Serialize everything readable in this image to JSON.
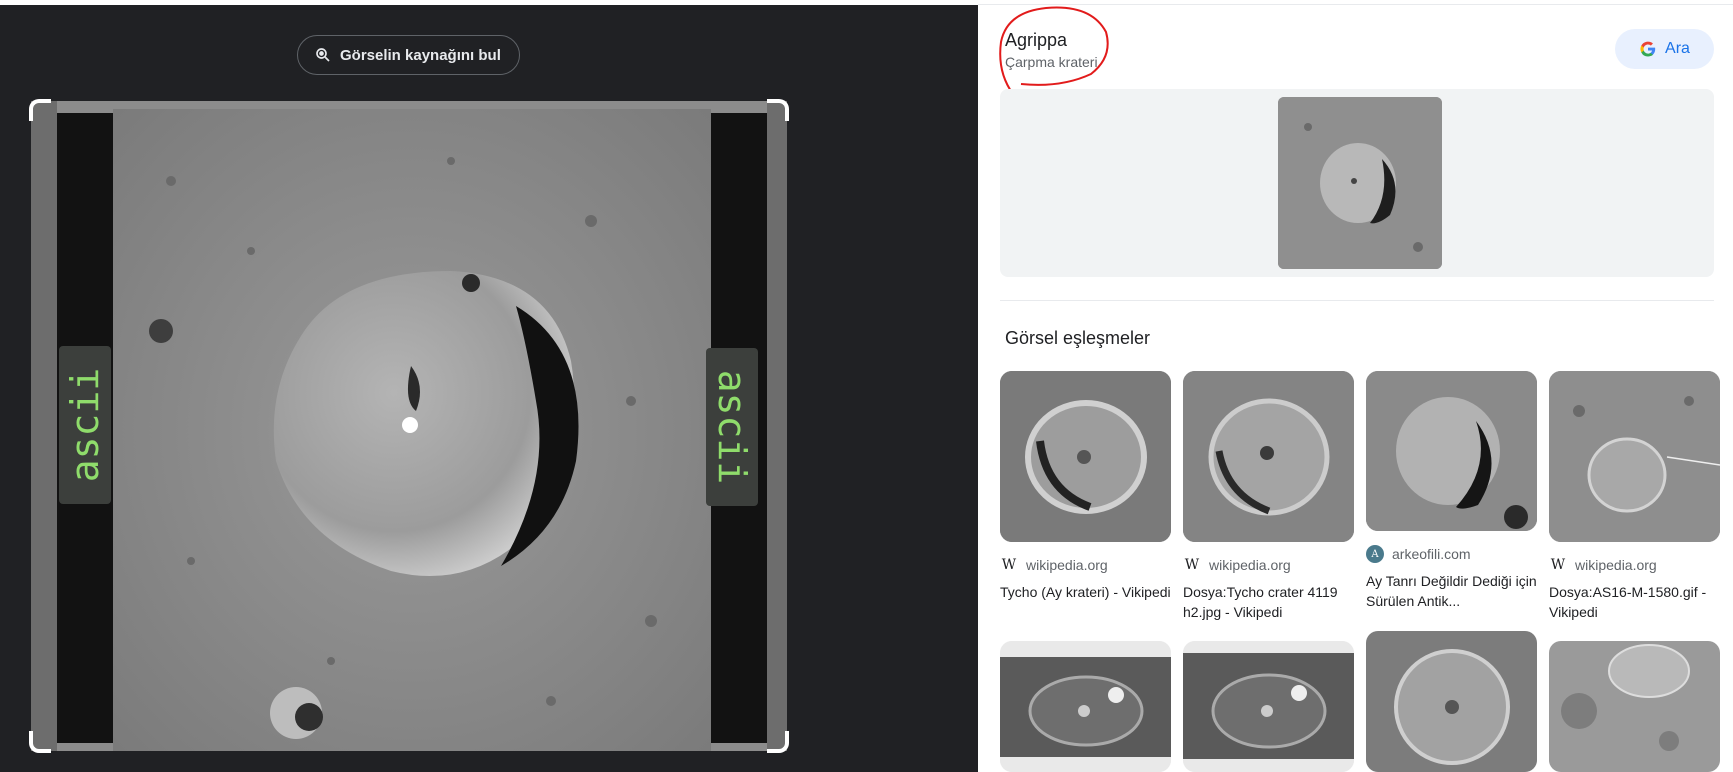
{
  "left_panel": {
    "source_button_label": "Görselin kaynağını bul",
    "ascii_tag_left": "ascii",
    "ascii_tag_right": "ascii"
  },
  "entity": {
    "title": "Agrippa",
    "subtitle": "Çarpma krateri",
    "search_button_label": "Ara"
  },
  "matches": {
    "heading": "Görsel eşleşmeler",
    "cards": [
      {
        "source": "wikipedia.org",
        "source_icon": "wikipedia-icon",
        "title": "Tycho (Ay krateri) - Vikipedi"
      },
      {
        "source": "wikipedia.org",
        "source_icon": "wikipedia-icon",
        "title": "Dosya:Tycho crater 4119 h2.jpg - Vikipedi"
      },
      {
        "source": "arkeofili.com",
        "source_icon": "arkeofili-icon",
        "title": "Ay Tanrı Değildir Dediği için Sürülen Antik..."
      },
      {
        "source": "wikipedia.org",
        "source_icon": "wikipedia-icon",
        "title": "Dosya:AS16-M-1580.gif - Vikipedi"
      }
    ]
  },
  "colors": {
    "dark_bg": "#202124",
    "accent": "#1a73e8",
    "annotation_red": "#e21b1b",
    "ascii_green": "#8fdc6b"
  }
}
